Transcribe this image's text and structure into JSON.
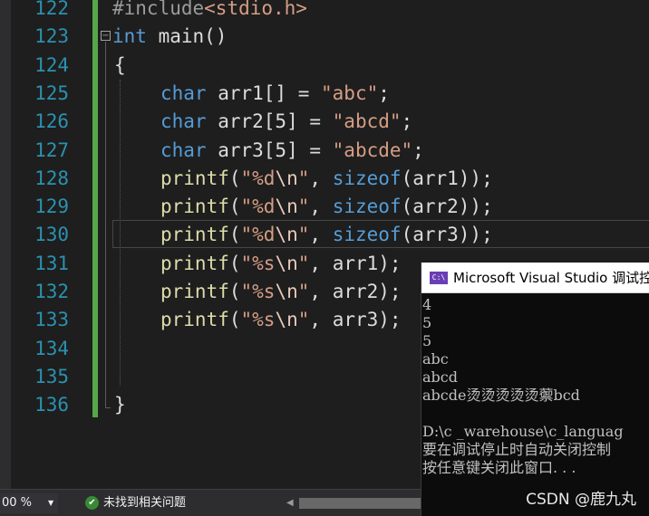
{
  "line_numbers": [
    "122",
    "123",
    "124",
    "125",
    "126",
    "127",
    "128",
    "129",
    "130",
    "131",
    "132",
    "133",
    "134",
    "135",
    "136"
  ],
  "code": {
    "l122": {
      "pp": "#include",
      "inc": "<stdio.h>"
    },
    "l123": {
      "kw": "int",
      "rest": " main()"
    },
    "l124": {
      "text": "{"
    },
    "l125": {
      "kw": "char",
      "mid": " arr1[] = ",
      "str": "\"abc\"",
      "end": ";"
    },
    "l126": {
      "kw": "char",
      "mid": " arr2[5] = ",
      "str": "\"abcd\"",
      "end": ";"
    },
    "l127": {
      "kw": "char",
      "mid": " arr3[5] = ",
      "str": "\"abcde\"",
      "end": ";"
    },
    "l128": {
      "fn": "printf",
      "p1": "(",
      "str1": "\"%d",
      "esc": "\\n",
      "str2": "\"",
      "p2": ", ",
      "kw": "sizeof",
      "rest": "(arr1));"
    },
    "l129": {
      "fn": "printf",
      "p1": "(",
      "str1": "\"%d",
      "esc": "\\n",
      "str2": "\"",
      "p2": ", ",
      "kw": "sizeof",
      "rest": "(arr2));"
    },
    "l130": {
      "fn": "printf",
      "p1": "(",
      "str1": "\"%d",
      "esc": "\\n",
      "str2": "\"",
      "p2": ", ",
      "kw": "sizeof",
      "rest": "(arr3));"
    },
    "l131": {
      "fn": "printf",
      "p1": "(",
      "str1": "\"%s",
      "esc": "\\n",
      "str2": "\"",
      "rest": ", arr1);"
    },
    "l132": {
      "fn": "printf",
      "p1": "(",
      "str1": "\"%s",
      "esc": "\\n",
      "str2": "\"",
      "rest": ", arr2);"
    },
    "l133": {
      "fn": "printf",
      "p1": "(",
      "str1": "\"%s",
      "esc": "\\n",
      "str2": "\"",
      "rest": ", arr3);"
    },
    "l136": {
      "text": "}"
    }
  },
  "console": {
    "icon_text": "C:\\",
    "title": "Microsoft Visual Studio 调试控",
    "output": [
      "4",
      "5",
      "5",
      "abc",
      "abcd",
      "abcde烫烫烫烫烫蘌bcd",
      "",
      "D:\\c _warehouse\\c_languag",
      "要在调试停止时自动关闭控制",
      "按任意键关闭此窗口. . ."
    ]
  },
  "watermark": "CSDN @鹿九丸",
  "statusbar": {
    "zoom": "00 %",
    "issues_icon": "✔",
    "issues": "未找到相关问题"
  },
  "colors": {
    "editor_bg": "#1e1e1e",
    "line_number": "#2b91af",
    "keyword": "#569cd6",
    "string": "#d69d85",
    "function": "#dcdcaa",
    "change_bar": "#57a64a"
  }
}
